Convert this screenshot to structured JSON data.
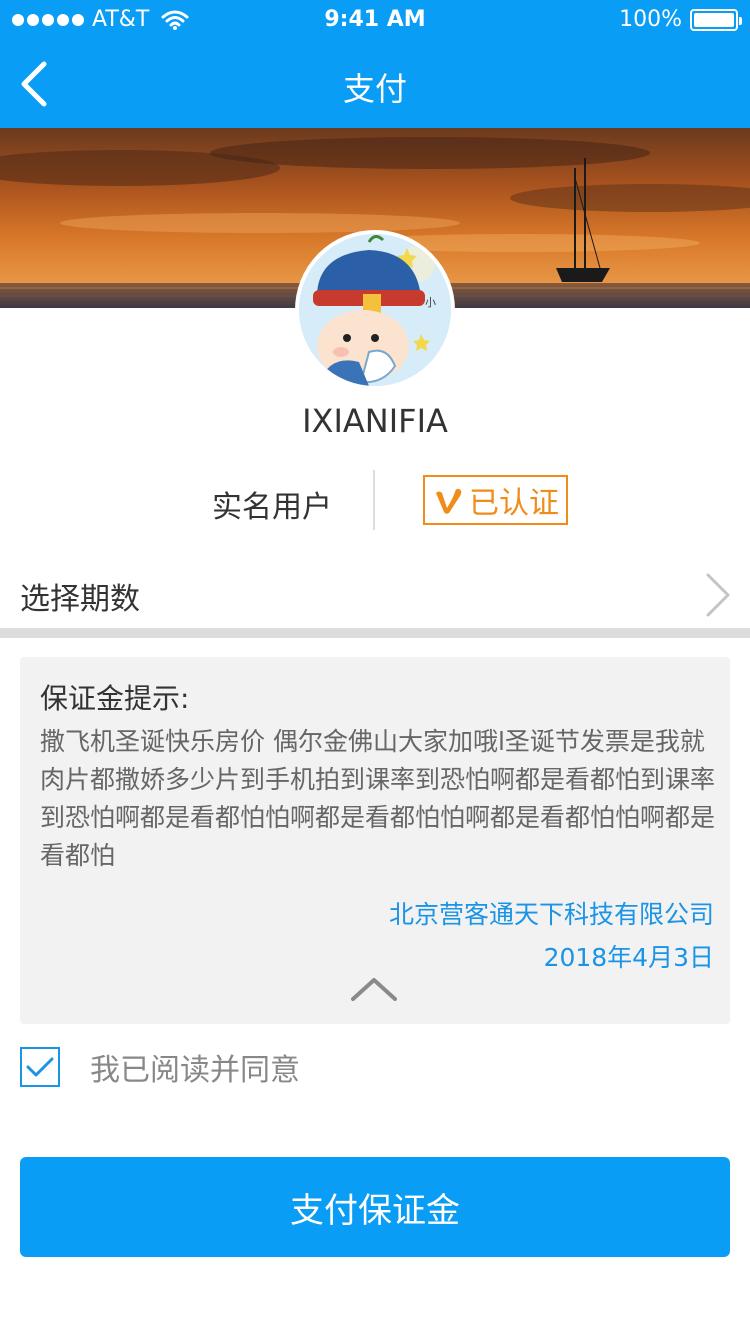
{
  "status_bar": {
    "carrier": "AT&T",
    "time": "9:41 AM",
    "battery_percent": "100%",
    "wifi_icon": "wifi-icon",
    "battery_icon": "battery-icon"
  },
  "nav": {
    "title": "支付",
    "back_icon": "chevron-left-icon"
  },
  "profile": {
    "username": "IXIANIFIA",
    "avatar_icon": "avatar-cartoon",
    "realname_label": "实名用户",
    "verified_label": "已认证",
    "verified_icon": "v-badge-icon"
  },
  "select_period": {
    "label": "选择期数",
    "chevron_icon": "chevron-right-icon"
  },
  "notice": {
    "title": "保证金提示:",
    "body": "撒飞机圣诞快乐房价 偶尔金佛山大家加哦l圣诞节发票是我就肉片都撒娇多少片到手机拍到课率到恐怕啊都是看都怕到课率到恐怕啊都是看都怕怕啊都是看都怕怕啊都是看都怕怕啊都是看都怕",
    "company": "北京营客通天下科技有限公司",
    "date": "2018年4月3日",
    "collapse_icon": "chevron-up-icon"
  },
  "agreement": {
    "checked": true,
    "label": "我已阅读并同意",
    "check_icon": "checkmark-icon"
  },
  "pay_button": {
    "label": "支付保证金"
  },
  "colors": {
    "primary": "#0a9df5",
    "link_blue": "#1a94e6",
    "verified_orange": "#f08c1a",
    "notice_bg": "#f2f2f2"
  }
}
